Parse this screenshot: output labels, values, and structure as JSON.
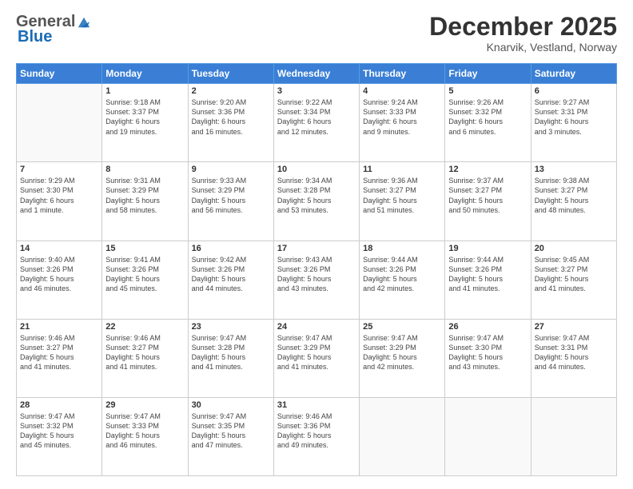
{
  "header": {
    "logo_general": "General",
    "logo_blue": "Blue",
    "month_title": "December 2025",
    "location": "Knarvik, Vestland, Norway"
  },
  "days_of_week": [
    "Sunday",
    "Monday",
    "Tuesday",
    "Wednesday",
    "Thursday",
    "Friday",
    "Saturday"
  ],
  "weeks": [
    [
      {
        "day": "",
        "info": ""
      },
      {
        "day": "1",
        "info": "Sunrise: 9:18 AM\nSunset: 3:37 PM\nDaylight: 6 hours\nand 19 minutes."
      },
      {
        "day": "2",
        "info": "Sunrise: 9:20 AM\nSunset: 3:36 PM\nDaylight: 6 hours\nand 16 minutes."
      },
      {
        "day": "3",
        "info": "Sunrise: 9:22 AM\nSunset: 3:34 PM\nDaylight: 6 hours\nand 12 minutes."
      },
      {
        "day": "4",
        "info": "Sunrise: 9:24 AM\nSunset: 3:33 PM\nDaylight: 6 hours\nand 9 minutes."
      },
      {
        "day": "5",
        "info": "Sunrise: 9:26 AM\nSunset: 3:32 PM\nDaylight: 6 hours\nand 6 minutes."
      },
      {
        "day": "6",
        "info": "Sunrise: 9:27 AM\nSunset: 3:31 PM\nDaylight: 6 hours\nand 3 minutes."
      }
    ],
    [
      {
        "day": "7",
        "info": "Sunrise: 9:29 AM\nSunset: 3:30 PM\nDaylight: 6 hours\nand 1 minute."
      },
      {
        "day": "8",
        "info": "Sunrise: 9:31 AM\nSunset: 3:29 PM\nDaylight: 5 hours\nand 58 minutes."
      },
      {
        "day": "9",
        "info": "Sunrise: 9:33 AM\nSunset: 3:29 PM\nDaylight: 5 hours\nand 56 minutes."
      },
      {
        "day": "10",
        "info": "Sunrise: 9:34 AM\nSunset: 3:28 PM\nDaylight: 5 hours\nand 53 minutes."
      },
      {
        "day": "11",
        "info": "Sunrise: 9:36 AM\nSunset: 3:27 PM\nDaylight: 5 hours\nand 51 minutes."
      },
      {
        "day": "12",
        "info": "Sunrise: 9:37 AM\nSunset: 3:27 PM\nDaylight: 5 hours\nand 50 minutes."
      },
      {
        "day": "13",
        "info": "Sunrise: 9:38 AM\nSunset: 3:27 PM\nDaylight: 5 hours\nand 48 minutes."
      }
    ],
    [
      {
        "day": "14",
        "info": "Sunrise: 9:40 AM\nSunset: 3:26 PM\nDaylight: 5 hours\nand 46 minutes."
      },
      {
        "day": "15",
        "info": "Sunrise: 9:41 AM\nSunset: 3:26 PM\nDaylight: 5 hours\nand 45 minutes."
      },
      {
        "day": "16",
        "info": "Sunrise: 9:42 AM\nSunset: 3:26 PM\nDaylight: 5 hours\nand 44 minutes."
      },
      {
        "day": "17",
        "info": "Sunrise: 9:43 AM\nSunset: 3:26 PM\nDaylight: 5 hours\nand 43 minutes."
      },
      {
        "day": "18",
        "info": "Sunrise: 9:44 AM\nSunset: 3:26 PM\nDaylight: 5 hours\nand 42 minutes."
      },
      {
        "day": "19",
        "info": "Sunrise: 9:44 AM\nSunset: 3:26 PM\nDaylight: 5 hours\nand 41 minutes."
      },
      {
        "day": "20",
        "info": "Sunrise: 9:45 AM\nSunset: 3:27 PM\nDaylight: 5 hours\nand 41 minutes."
      }
    ],
    [
      {
        "day": "21",
        "info": "Sunrise: 9:46 AM\nSunset: 3:27 PM\nDaylight: 5 hours\nand 41 minutes."
      },
      {
        "day": "22",
        "info": "Sunrise: 9:46 AM\nSunset: 3:27 PM\nDaylight: 5 hours\nand 41 minutes."
      },
      {
        "day": "23",
        "info": "Sunrise: 9:47 AM\nSunset: 3:28 PM\nDaylight: 5 hours\nand 41 minutes."
      },
      {
        "day": "24",
        "info": "Sunrise: 9:47 AM\nSunset: 3:29 PM\nDaylight: 5 hours\nand 41 minutes."
      },
      {
        "day": "25",
        "info": "Sunrise: 9:47 AM\nSunset: 3:29 PM\nDaylight: 5 hours\nand 42 minutes."
      },
      {
        "day": "26",
        "info": "Sunrise: 9:47 AM\nSunset: 3:30 PM\nDaylight: 5 hours\nand 43 minutes."
      },
      {
        "day": "27",
        "info": "Sunrise: 9:47 AM\nSunset: 3:31 PM\nDaylight: 5 hours\nand 44 minutes."
      }
    ],
    [
      {
        "day": "28",
        "info": "Sunrise: 9:47 AM\nSunset: 3:32 PM\nDaylight: 5 hours\nand 45 minutes."
      },
      {
        "day": "29",
        "info": "Sunrise: 9:47 AM\nSunset: 3:33 PM\nDaylight: 5 hours\nand 46 minutes."
      },
      {
        "day": "30",
        "info": "Sunrise: 9:47 AM\nSunset: 3:35 PM\nDaylight: 5 hours\nand 47 minutes."
      },
      {
        "day": "31",
        "info": "Sunrise: 9:46 AM\nSunset: 3:36 PM\nDaylight: 5 hours\nand 49 minutes."
      },
      {
        "day": "",
        "info": ""
      },
      {
        "day": "",
        "info": ""
      },
      {
        "day": "",
        "info": ""
      }
    ]
  ]
}
